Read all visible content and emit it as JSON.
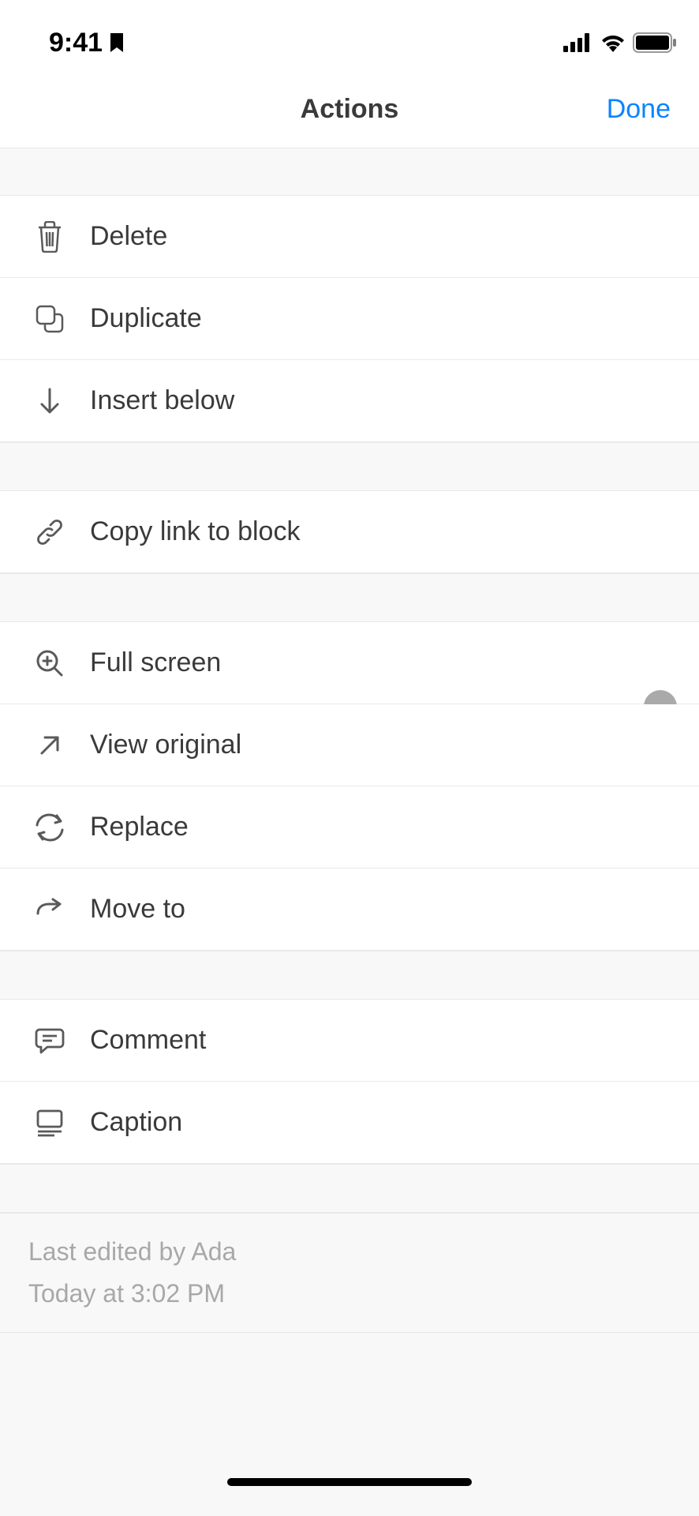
{
  "statusBar": {
    "time": "9:41"
  },
  "header": {
    "title": "Actions",
    "done": "Done"
  },
  "actions": {
    "group1": [
      {
        "id": "delete",
        "label": "Delete",
        "icon": "trash"
      },
      {
        "id": "duplicate",
        "label": "Duplicate",
        "icon": "copy"
      },
      {
        "id": "insert-below",
        "label": "Insert below",
        "icon": "arrow-down"
      }
    ],
    "group2": [
      {
        "id": "copy-link",
        "label": "Copy link to block",
        "icon": "link"
      }
    ],
    "group3": [
      {
        "id": "full-screen",
        "label": "Full screen",
        "icon": "zoom"
      },
      {
        "id": "view-original",
        "label": "View original",
        "icon": "arrow-up-right"
      },
      {
        "id": "replace",
        "label": "Replace",
        "icon": "sync"
      },
      {
        "id": "move-to",
        "label": "Move to",
        "icon": "arrow-right"
      }
    ],
    "group4": [
      {
        "id": "comment",
        "label": "Comment",
        "icon": "comment"
      },
      {
        "id": "caption",
        "label": "Caption",
        "icon": "caption"
      }
    ]
  },
  "footer": {
    "editedBy": "Last edited by Ada",
    "timestamp": "Today at 3:02 PM"
  }
}
